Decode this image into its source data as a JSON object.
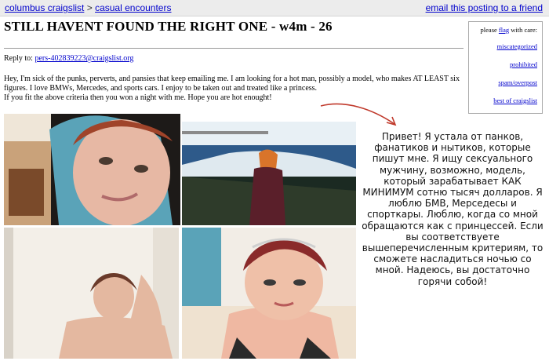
{
  "breadcrumb": {
    "site": "columbus craigslist",
    "separator": ">",
    "category": "casual encounters"
  },
  "email_link": "email this posting to a friend",
  "post": {
    "title": "STILL HAVENT FOUND THE RIGHT ONE - w4m - 26",
    "reply_label": "Reply to:",
    "reply_email": "pers-402839223@craigslist.org",
    "body_line_1": "Hey, I'm sick of the punks, perverts, and pansies that keep emailing me. I am looking for a hot man, possibly a model, who makes AT LEAST six figures. I love BMWs, Mercedes, and sports cars. I enjoy to be taken out and treated like a princess.",
    "body_line_2": "If you fit the above criteria then you won a night with me. Hope you are hot enought!"
  },
  "flag_box": {
    "prefix": "please",
    "flag_link": "flag",
    "suffix": "with care:",
    "items": [
      "miscategorized",
      "prohibited",
      "spam/overpost",
      "best of craigslist"
    ]
  },
  "translation": "Привет! Я устала от панков, фанатиков и нытиков, которые пишут мне. Я ищу сексуального мужчину, возможно, модель, который зарабатывает КАК МИНИМУМ сотню тысяч долларов. Я люблю БМВ, Мерседесы и спорткары. Люблю, когда со мной обращаются как с принцессей. Если вы соответствуете вышеперечисленным критериям, то сможете насладиться ночью со мной. Надеюсь, вы достаточно горячи собой!",
  "colors": {
    "link": "#0000cc",
    "arrow": "#c0392b",
    "topbar": "#ececec"
  }
}
